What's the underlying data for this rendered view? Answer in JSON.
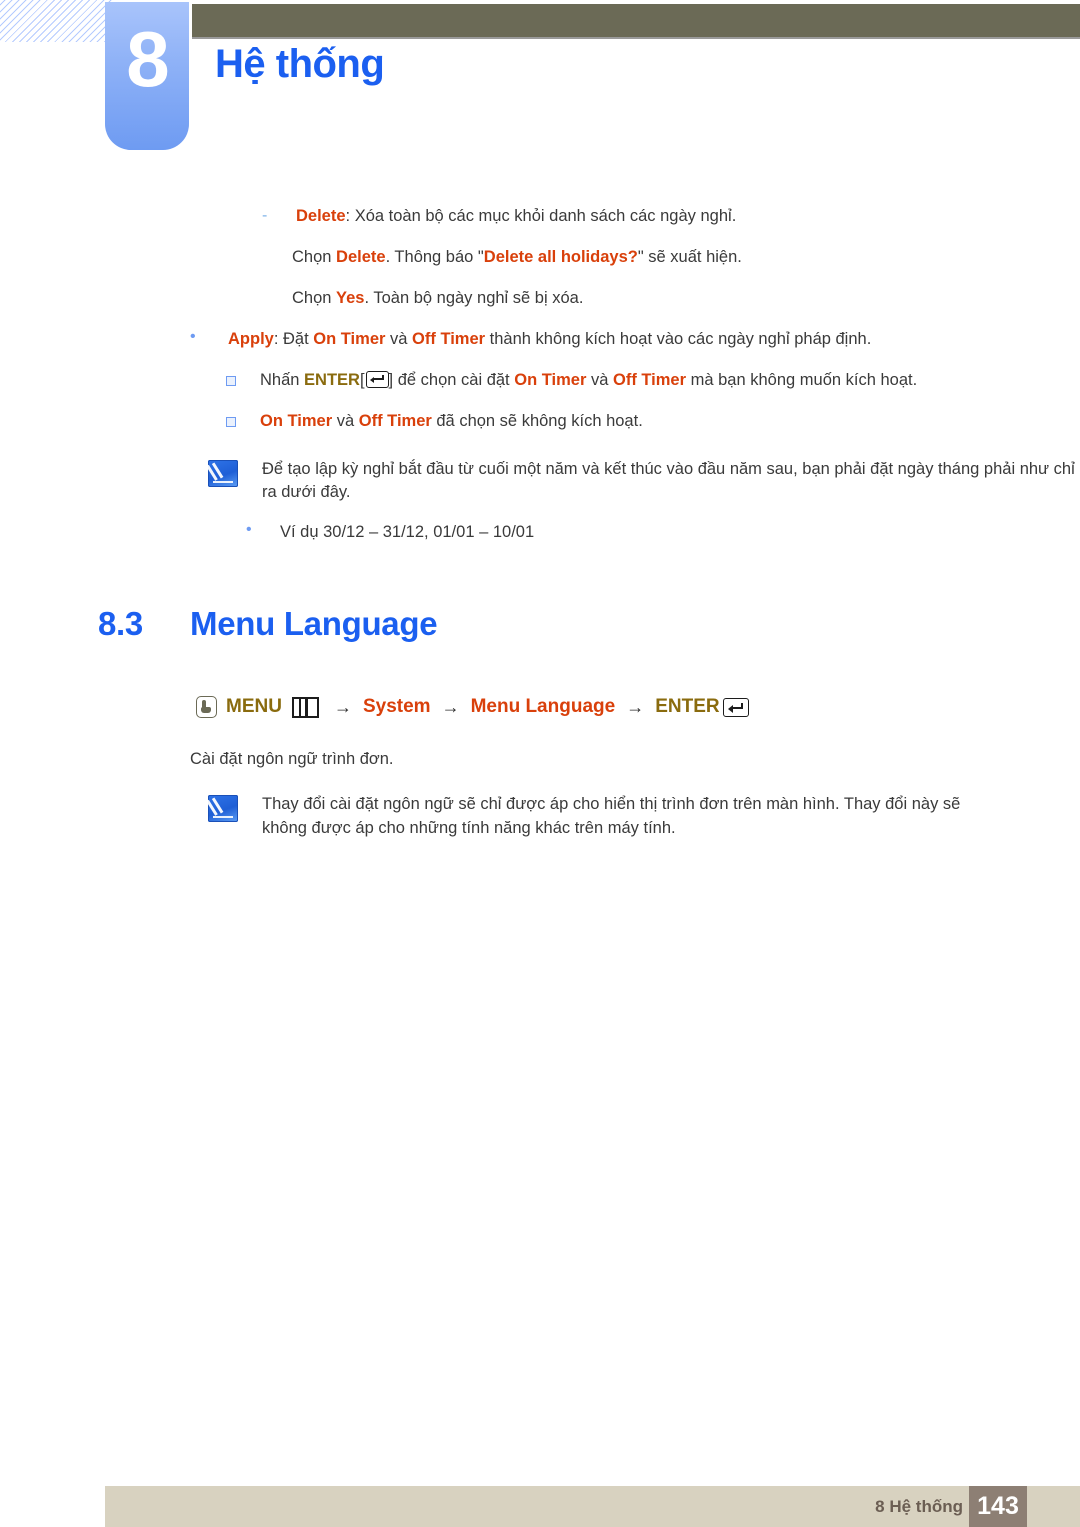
{
  "header": {
    "chapter_number": "8",
    "chapter_title": "Hệ thống",
    "accent_blue": "#1b5ff0",
    "olive_bar_color": "#6b6a56"
  },
  "colors": {
    "accent_red": "#d9400b",
    "accent_gold": "#8a6b0e",
    "heading_blue": "#1b5ff0",
    "footer_bar": "#d8d2c0",
    "footer_page_box": "#8d7f74"
  },
  "content": {
    "delete_item": {
      "marker": "-",
      "term": "Delete",
      "rest": ": Xóa toàn bộ các mục khỏi danh sách các ngày nghỉ."
    },
    "delete_line2": {
      "pre": "Chọn ",
      "term": "Delete",
      "mid": ". Thông báo \"",
      "term2": "Delete all holidays?",
      "post": "\" sẽ xuất hiện."
    },
    "delete_line3": {
      "pre": "Chọn ",
      "term": "Yes",
      "post": ". Toàn bộ ngày nghỉ sẽ bị xóa."
    },
    "apply_item": {
      "term": "Apply",
      "seg1": ": Đặt ",
      "term2": "On Timer",
      "seg2": " và ",
      "term3": "Off Timer",
      "seg3": " thành không kích hoạt vào các ngày nghỉ pháp định."
    },
    "enter_sub": {
      "pre": "Nhấn ",
      "enter_label": "ENTER",
      "bracket_open": "[",
      "bracket_close": "]",
      "seg1": " để chọn cài đặt ",
      "term1": "On Timer",
      "seg2": " và ",
      "term2": "Off Timer",
      "seg3": " mà bạn không muốn kích hoạt."
    },
    "timer_sub": {
      "term1": "On Timer",
      "seg1": " và ",
      "term2": "Off Timer",
      "seg2": " đã chọn sẽ không kích hoạt."
    },
    "note_holiday": {
      "icon": "note-pencil-icon",
      "text": "Để tạo lập kỳ nghỉ bắt đầu từ cuối một năm và kết thúc vào đầu năm sau, bạn phải đặt ngày tháng phải như chỉ ra dưới đây.",
      "example": "Ví dụ 30/12 – 31/12, 01/01 – 10/01"
    }
  },
  "section": {
    "number": "8.3",
    "title": "Menu Language"
  },
  "breadcrumb": {
    "hand_icon": "hand-press-icon",
    "menu_label": "MENU",
    "menu_icon": "menu-grid-icon",
    "arrow": "→",
    "system_label": "System",
    "menu_language_label": "Menu Language",
    "enter_label": "ENTER",
    "enter_icon": "enter-key-icon"
  },
  "setting_desc": "Cài đặt ngôn ngữ trình đơn.",
  "language_note": {
    "icon": "note-pencil-icon",
    "text": "Thay đổi cài đặt ngôn ngữ sẽ chỉ được áp cho hiển thị trình đơn trên màn hình. Thay đổi này sẽ không được áp cho những tính năng khác trên máy tính."
  },
  "footer": {
    "label": "8 Hệ thống",
    "page_number": "143"
  }
}
